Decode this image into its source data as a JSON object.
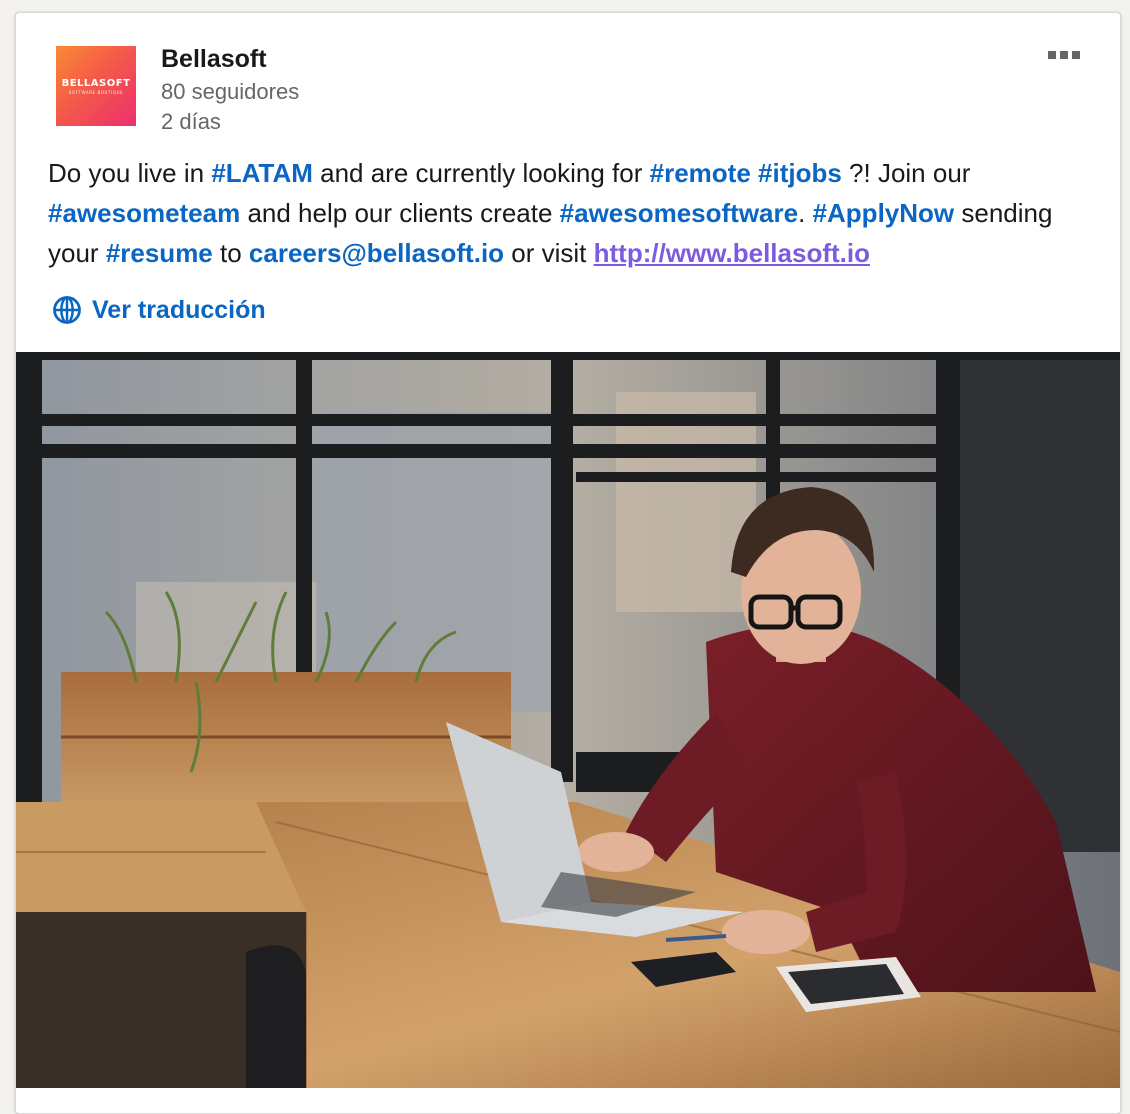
{
  "company": {
    "name": "Bellasoft",
    "followers": "80 seguidores",
    "posted": "2 días",
    "logo_text": "BELLASOFT",
    "logo_tagline": "SOFTWARE BOUTIQUE",
    "logo_gradient": [
      "#f98a33",
      "#ec2f6d"
    ]
  },
  "menu": {
    "icon": "more-horizontal-icon"
  },
  "post": {
    "t1": "Do you live in ",
    "tag_latam": "#LATAM",
    "t2": " and are currently looking for ",
    "tag_remote": "#remote",
    "t3": " ",
    "tag_itjobs": "#itjobs",
    "t4": " ?! Join our ",
    "tag_awesometeam": "#awesometeam",
    "t5": " and help our clients create ",
    "tag_awesomesoftware": "#awesomesoftware",
    "t6": ". ",
    "tag_applynow": "#ApplyNow",
    "t7": " sending your ",
    "tag_resume": "#resume",
    "t8": " to ",
    "email": "careers@bellasoft.io",
    "t9": " or visit ",
    "url": "http://www.bellasoft.io"
  },
  "translate": {
    "label": "Ver traducción",
    "icon": "globe-icon"
  },
  "colors": {
    "link": "#0a66c2",
    "visited_link": "#7b5ce0",
    "secondary_text": "#666666"
  }
}
